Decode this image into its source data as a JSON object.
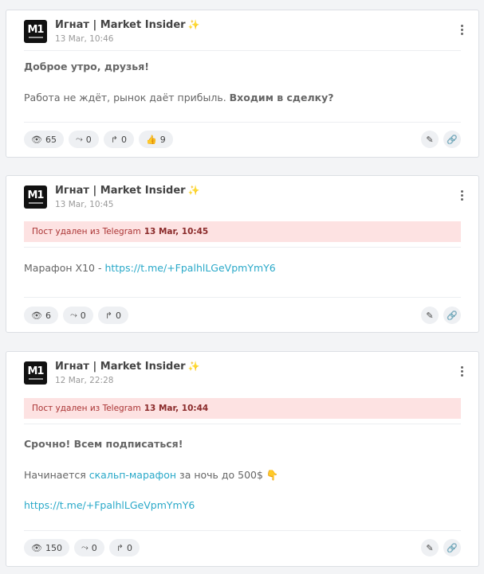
{
  "posts": [
    {
      "author": "Игнат | Market Insider",
      "time": "13 Mar, 10:46",
      "deleted_text": "",
      "deleted_time": "",
      "line1": "Доброе утро, друзья!",
      "line2_plain": "Работа не ждёт, рынок даёт прибыль.",
      "line2_bold": "Входим в сделку?",
      "stats": {
        "views": "65",
        "shares": "0",
        "reposts": "0",
        "likes": "9"
      }
    },
    {
      "author": "Игнат | Market Insider",
      "time": "13 Mar, 10:45",
      "deleted_text": "Пост удален из Telegram",
      "deleted_time": "13 Mar, 10:45",
      "line1_plain": "Марафон X10 - ",
      "line1_link": "https://t.me/+FpalhlLGeVpmYmY6",
      "stats": {
        "views": "6",
        "shares": "0",
        "reposts": "0"
      }
    },
    {
      "author": "Игнат | Market Insider",
      "time": "12 Mar, 22:28",
      "deleted_text": "Пост удален из Telegram",
      "deleted_time": "13 Mar, 10:44",
      "line1": "Срочно! Всем подписаться!",
      "line2_plain_a": "Начинается ",
      "line2_link": "скальп-марафон",
      "line2_plain_b": " за ночь до 500$ 👇",
      "line3_link": "https://t.me/+FpalhlLGeVpmYmY6",
      "stats": {
        "views": "150",
        "shares": "0",
        "reposts": "0"
      }
    }
  ],
  "icons": {
    "views": "eye-icon",
    "shares": "share-icon",
    "reposts": "repost-icon",
    "likes": "thumbs-up-icon",
    "edit": "pencil-icon",
    "link": "link-icon",
    "menu": "more-vertical-icon"
  },
  "colors": {
    "deleted_bg": "#fde2e2",
    "link": "#2aa9c9"
  }
}
